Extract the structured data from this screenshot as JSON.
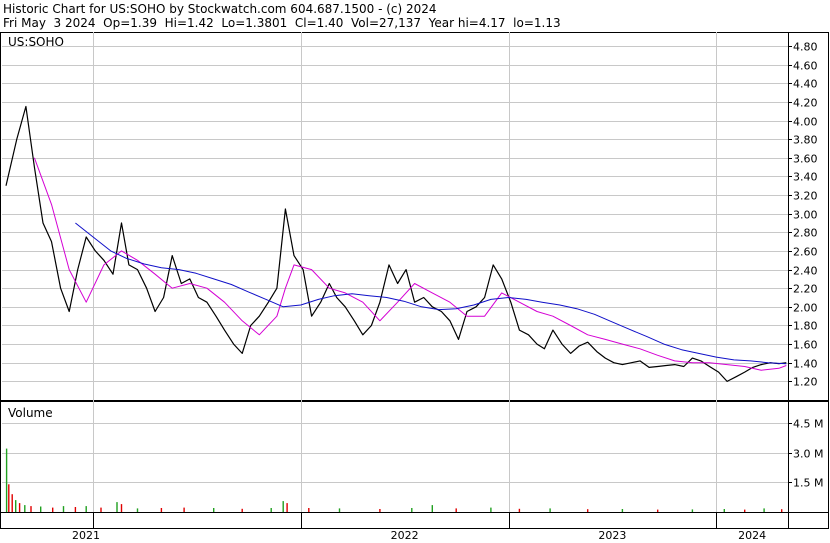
{
  "header": {
    "line1": "Historic Chart for US:SOHO by Stockwatch.com 604.687.1500 - (c) 2024",
    "line2": "Fri May  3 2024  Op=1.39  Hi=1.42  Lo=1.3801  Cl=1.40  Vol=27,137  Year hi=4.17  lo=1.13"
  },
  "colors": {
    "price": "#000000",
    "ma_short": "#d400d4",
    "ma_long": "#1010c8",
    "vol_up": "#20a020",
    "vol_down": "#e00000",
    "grid": "#c8c8c8",
    "border": "#000000"
  },
  "chart_data": [
    {
      "type": "line",
      "symbol_label": "US:SOHO",
      "ylim": [
        1.0,
        4.95
      ],
      "y_ticks": [
        "4.80",
        "4.60",
        "4.40",
        "4.20",
        "4.00",
        "3.80",
        "3.60",
        "3.40",
        "3.20",
        "3.00",
        "2.80",
        "2.60",
        "2.40",
        "2.20",
        "2.00",
        "1.80",
        "1.60",
        "1.40",
        "1.20"
      ],
      "x_labels": [
        "2021",
        "2022",
        "2023",
        "2024"
      ],
      "series": [
        {
          "role": "price",
          "x": [
            "2020-08-01",
            "2020-08-20",
            "2020-09-05",
            "2020-09-20",
            "2020-10-05",
            "2020-10-20",
            "2020-11-05",
            "2020-11-20",
            "2020-12-05",
            "2020-12-20",
            "2021-01-05",
            "2021-01-20",
            "2021-02-05",
            "2021-02-20",
            "2021-03-05",
            "2021-03-20",
            "2021-04-05",
            "2021-04-20",
            "2021-05-05",
            "2021-05-20",
            "2021-06-05",
            "2021-06-20",
            "2021-07-05",
            "2021-07-20",
            "2021-08-05",
            "2021-08-20",
            "2021-09-05",
            "2021-09-20",
            "2021-10-05",
            "2021-10-20",
            "2021-11-05",
            "2021-11-20",
            "2021-12-05",
            "2021-12-20",
            "2022-01-05",
            "2022-01-20",
            "2022-02-05",
            "2022-02-20",
            "2022-03-05",
            "2022-03-20",
            "2022-04-05",
            "2022-04-20",
            "2022-05-05",
            "2022-05-20",
            "2022-06-05",
            "2022-06-20",
            "2022-07-05",
            "2022-07-20",
            "2022-08-05",
            "2022-08-20",
            "2022-09-05",
            "2022-09-20",
            "2022-10-05",
            "2022-10-20",
            "2022-11-05",
            "2022-11-20",
            "2022-12-05",
            "2022-12-20",
            "2023-01-05",
            "2023-01-20",
            "2023-02-05",
            "2023-02-20",
            "2023-03-05",
            "2023-03-20",
            "2023-04-05",
            "2023-04-20",
            "2023-05-05",
            "2023-05-20",
            "2023-06-05",
            "2023-06-20",
            "2023-07-05",
            "2023-07-20",
            "2023-08-05",
            "2023-08-20",
            "2023-09-05",
            "2023-09-20",
            "2023-10-05",
            "2023-10-20",
            "2023-11-05",
            "2023-11-20",
            "2023-12-05",
            "2023-12-20",
            "2024-01-05",
            "2024-01-20",
            "2024-02-05",
            "2024-02-20",
            "2024-03-05",
            "2024-03-20",
            "2024-04-05",
            "2024-04-20",
            "2024-05-03"
          ],
          "values": [
            3.3,
            3.8,
            4.15,
            3.5,
            2.9,
            2.7,
            2.2,
            1.95,
            2.4,
            2.75,
            2.6,
            2.5,
            2.35,
            2.9,
            2.45,
            2.4,
            2.2,
            1.95,
            2.1,
            2.55,
            2.25,
            2.3,
            2.1,
            2.05,
            1.9,
            1.75,
            1.6,
            1.5,
            1.8,
            1.9,
            2.05,
            2.2,
            3.05,
            2.55,
            2.4,
            1.9,
            2.05,
            2.25,
            2.1,
            2.0,
            1.85,
            1.7,
            1.8,
            2.05,
            2.45,
            2.25,
            2.4,
            2.05,
            2.1,
            2.0,
            1.95,
            1.85,
            1.65,
            1.95,
            2.0,
            2.1,
            2.45,
            2.3,
            2.05,
            1.75,
            1.7,
            1.6,
            1.55,
            1.75,
            1.6,
            1.5,
            1.58,
            1.62,
            1.52,
            1.45,
            1.4,
            1.38,
            1.4,
            1.42,
            1.35,
            1.36,
            1.37,
            1.38,
            1.36,
            1.45,
            1.42,
            1.36,
            1.3,
            1.2,
            1.25,
            1.3,
            1.35,
            1.38,
            1.4,
            1.39,
            1.4
          ]
        },
        {
          "role": "moving-average-short",
          "x": [
            "2020-09-20",
            "2020-10-20",
            "2020-11-20",
            "2020-12-20",
            "2021-01-20",
            "2021-02-20",
            "2021-03-20",
            "2021-04-20",
            "2021-05-20",
            "2021-06-20",
            "2021-07-20",
            "2021-08-20",
            "2021-09-20",
            "2021-10-20",
            "2021-11-20",
            "2021-12-05",
            "2021-12-20",
            "2022-01-20",
            "2022-02-20",
            "2022-03-20",
            "2022-04-20",
            "2022-05-20",
            "2022-06-20",
            "2022-07-20",
            "2022-08-20",
            "2022-09-20",
            "2022-10-20",
            "2022-11-20",
            "2022-12-20",
            "2023-01-20",
            "2023-02-20",
            "2023-03-20",
            "2023-04-20",
            "2023-05-20",
            "2023-06-20",
            "2023-07-20",
            "2023-08-20",
            "2023-09-20",
            "2023-10-20",
            "2023-11-20",
            "2023-12-20",
            "2024-01-20",
            "2024-02-20",
            "2024-03-20",
            "2024-04-20",
            "2024-05-03"
          ],
          "values": [
            3.6,
            3.1,
            2.4,
            2.05,
            2.45,
            2.6,
            2.5,
            2.35,
            2.2,
            2.25,
            2.2,
            2.05,
            1.85,
            1.7,
            1.9,
            2.2,
            2.45,
            2.4,
            2.2,
            2.15,
            2.05,
            1.85,
            2.05,
            2.25,
            2.15,
            2.05,
            1.9,
            1.9,
            2.15,
            2.05,
            1.95,
            1.9,
            1.8,
            1.7,
            1.65,
            1.6,
            1.55,
            1.48,
            1.42,
            1.4,
            1.4,
            1.38,
            1.36,
            1.32,
            1.34,
            1.37
          ]
        },
        {
          "role": "moving-average-long",
          "x": [
            "2020-12-01",
            "2021-01-01",
            "2021-02-01",
            "2021-03-01",
            "2021-04-01",
            "2021-05-01",
            "2021-06-01",
            "2021-07-01",
            "2021-08-01",
            "2021-09-01",
            "2021-10-01",
            "2021-11-01",
            "2021-12-01",
            "2022-01-01",
            "2022-02-01",
            "2022-03-01",
            "2022-04-01",
            "2022-05-01",
            "2022-06-01",
            "2022-07-01",
            "2022-08-01",
            "2022-09-01",
            "2022-10-01",
            "2022-11-01",
            "2022-12-01",
            "2023-01-01",
            "2023-02-01",
            "2023-03-01",
            "2023-04-01",
            "2023-05-01",
            "2023-06-01",
            "2023-07-01",
            "2023-08-01",
            "2023-09-01",
            "2023-10-01",
            "2023-11-01",
            "2023-12-01",
            "2024-01-01",
            "2024-02-01",
            "2024-03-01",
            "2024-04-01",
            "2024-05-03"
          ],
          "values": [
            2.9,
            2.75,
            2.6,
            2.52,
            2.46,
            2.42,
            2.4,
            2.36,
            2.3,
            2.24,
            2.16,
            2.08,
            2.0,
            2.02,
            2.08,
            2.12,
            2.14,
            2.12,
            2.1,
            2.06,
            2.0,
            1.97,
            1.98,
            2.02,
            2.08,
            2.1,
            2.08,
            2.05,
            2.02,
            1.98,
            1.92,
            1.84,
            1.76,
            1.68,
            1.6,
            1.54,
            1.5,
            1.46,
            1.43,
            1.42,
            1.4,
            1.39
          ]
        }
      ]
    },
    {
      "type": "bar",
      "title": "Volume",
      "y_ticks": [
        "4.5 M",
        "3.0 M",
        "1.5 M"
      ],
      "ylim": [
        0,
        5.4
      ],
      "bars": [
        {
          "x": "2020-08-02",
          "value": 3.2,
          "dir": "up"
        },
        {
          "x": "2020-08-06",
          "value": 1.4,
          "dir": "down"
        },
        {
          "x": "2020-08-12",
          "value": 0.9,
          "dir": "down"
        },
        {
          "x": "2020-08-18",
          "value": 0.6,
          "dir": "up"
        },
        {
          "x": "2020-08-25",
          "value": 0.45,
          "dir": "down"
        },
        {
          "x": "2020-09-03",
          "value": 0.35,
          "dir": "up"
        },
        {
          "x": "2020-09-14",
          "value": 0.3,
          "dir": "down"
        },
        {
          "x": "2020-10-01",
          "value": 0.28,
          "dir": "up"
        },
        {
          "x": "2020-10-22",
          "value": 0.22,
          "dir": "down"
        },
        {
          "x": "2020-11-10",
          "value": 0.3,
          "dir": "up"
        },
        {
          "x": "2020-12-01",
          "value": 0.25,
          "dir": "down"
        },
        {
          "x": "2020-12-20",
          "value": 0.3,
          "dir": "up"
        },
        {
          "x": "2021-01-15",
          "value": 0.22,
          "dir": "down"
        },
        {
          "x": "2021-02-12",
          "value": 0.5,
          "dir": "up"
        },
        {
          "x": "2021-02-20",
          "value": 0.4,
          "dir": "down"
        },
        {
          "x": "2021-03-20",
          "value": 0.18,
          "dir": "up"
        },
        {
          "x": "2021-05-01",
          "value": 0.2,
          "dir": "down"
        },
        {
          "x": "2021-06-10",
          "value": 0.22,
          "dir": "down"
        },
        {
          "x": "2021-08-01",
          "value": 0.2,
          "dir": "up"
        },
        {
          "x": "2021-09-20",
          "value": 0.16,
          "dir": "down"
        },
        {
          "x": "2021-11-10",
          "value": 0.2,
          "dir": "up"
        },
        {
          "x": "2021-12-01",
          "value": 0.55,
          "dir": "up"
        },
        {
          "x": "2021-12-08",
          "value": 0.45,
          "dir": "down"
        },
        {
          "x": "2022-01-15",
          "value": 0.2,
          "dir": "down"
        },
        {
          "x": "2022-03-10",
          "value": 0.18,
          "dir": "up"
        },
        {
          "x": "2022-05-20",
          "value": 0.15,
          "dir": "down"
        },
        {
          "x": "2022-07-15",
          "value": 0.2,
          "dir": "up"
        },
        {
          "x": "2022-08-20",
          "value": 0.35,
          "dir": "up"
        },
        {
          "x": "2022-10-01",
          "value": 0.18,
          "dir": "down"
        },
        {
          "x": "2022-12-01",
          "value": 0.22,
          "dir": "up"
        },
        {
          "x": "2023-01-20",
          "value": 0.16,
          "dir": "down"
        },
        {
          "x": "2023-03-15",
          "value": 0.18,
          "dir": "up"
        },
        {
          "x": "2023-05-20",
          "value": 0.14,
          "dir": "down"
        },
        {
          "x": "2023-07-20",
          "value": 0.15,
          "dir": "up"
        },
        {
          "x": "2023-09-20",
          "value": 0.12,
          "dir": "down"
        },
        {
          "x": "2023-11-20",
          "value": 0.13,
          "dir": "up"
        },
        {
          "x": "2024-01-15",
          "value": 0.15,
          "dir": "up"
        },
        {
          "x": "2024-02-20",
          "value": 0.12,
          "dir": "down"
        },
        {
          "x": "2024-03-25",
          "value": 0.18,
          "dir": "up"
        },
        {
          "x": "2024-04-25",
          "value": 0.14,
          "dir": "down"
        }
      ]
    }
  ]
}
